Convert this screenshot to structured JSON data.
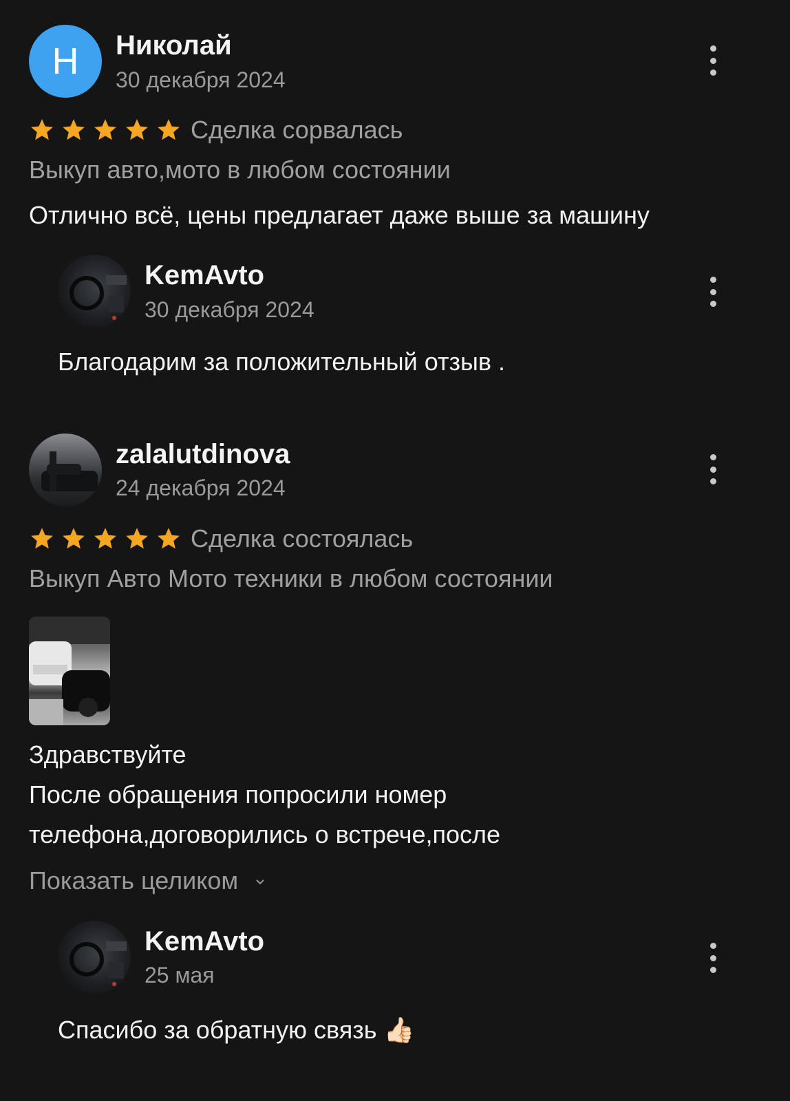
{
  "colors": {
    "background": "#151515",
    "star": "#f5a623",
    "avatar_letter_bg": "#3ea2f0"
  },
  "reviews": [
    {
      "avatar_letter": "Н",
      "author": "Николай",
      "date": "30 декабря 2024",
      "rating": 5,
      "status": "Сделка сорвалась",
      "service": "Выкуп авто,мото в любом состоянии",
      "text": "Отлично всё, цены предлагает даже выше за машину",
      "reply": {
        "author": "KemAvto",
        "date": "30 декабря 2024",
        "text": "Благодарим за положительный отзыв ."
      }
    },
    {
      "author": "zalalutdinova",
      "date": "24 декабря 2024",
      "rating": 5,
      "status": "Сделка состоялась",
      "service": "Выкуп Авто Мото техники в любом состоянии",
      "text_lines": [
        "Здравствуйте",
        "После обращения попросили номер",
        "телефона,договорились о встрече,после"
      ],
      "show_more": "Показать целиком",
      "reply": {
        "author": "KemAvto",
        "date": "25 мая",
        "text": "Спасибо за обратную связь 👍🏻"
      }
    }
  ],
  "icons": {
    "menu": "more-vertical-icon",
    "star": "star-icon",
    "chevron": "chevron-down-icon"
  }
}
